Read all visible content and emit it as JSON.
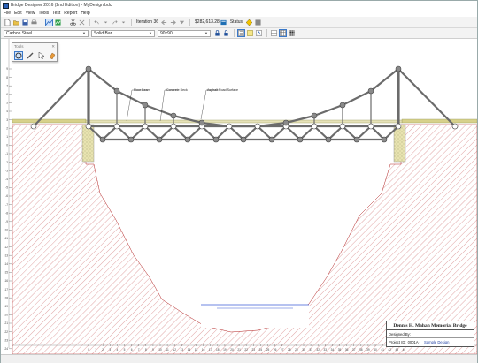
{
  "window": {
    "title": "Bridge Designer 2016 (2nd Edition) - MyDesign.bdc"
  },
  "menu": [
    "File",
    "Edit",
    "View",
    "Tools",
    "Test",
    "Report",
    "Help"
  ],
  "toolbar": {
    "iteration_label": "Iteration 36",
    "cost": "$282,613.28",
    "status_label": "Status:"
  },
  "member_props": {
    "material": "Carbon Steel",
    "section": "Solid Bar",
    "size": "90x90"
  },
  "tools_palette": {
    "title": "Tools"
  },
  "annotations": {
    "floor_beam": "Floor Beam",
    "concrete_deck": "Concrete Deck",
    "asphalt": "Asphalt Road Surface"
  },
  "ruler": {
    "x_ticks": [
      "0",
      "1",
      "2",
      "3",
      "4",
      "5",
      "6",
      "7",
      "8",
      "9",
      "10",
      "11",
      "12",
      "13",
      "14",
      "15",
      "16",
      "17",
      "18",
      "19",
      "20",
      "21",
      "22",
      "23",
      "24",
      "25",
      "26",
      "27",
      "28",
      "29",
      "30",
      "31",
      "32",
      "33",
      "34",
      "35",
      "36",
      "37",
      "38",
      "39",
      "40",
      "41",
      "42",
      "43",
      "44"
    ],
    "y_ticks": [
      "9",
      "8",
      "7",
      "6",
      "5",
      "4",
      "3",
      "2",
      "1",
      "0",
      "-1",
      "-2",
      "-3",
      "-4",
      "-5",
      "-6",
      "-7",
      "-8",
      "-9",
      "-10",
      "-11",
      "-12",
      "-13",
      "-14",
      "-15",
      "-16",
      "-17",
      "-18",
      "-19",
      "-20",
      "-21",
      "-22",
      "-23",
      "-24"
    ]
  },
  "title_block": {
    "bridge_name": "Dennis H. Mahan Memorial Bridge",
    "designed_by_label": "Designed By:",
    "designed_by": "",
    "project_id_label": "Project ID:",
    "project_id": "0001A -",
    "sample": "Sample Design"
  },
  "colors": {
    "member": "#6b6b6b",
    "joint_fill": "#8a8a8a",
    "terrain_hatch": "#b22222",
    "water": "#3b5bd6",
    "deck": "#c9c98a",
    "abutment": "#d7d18b"
  }
}
